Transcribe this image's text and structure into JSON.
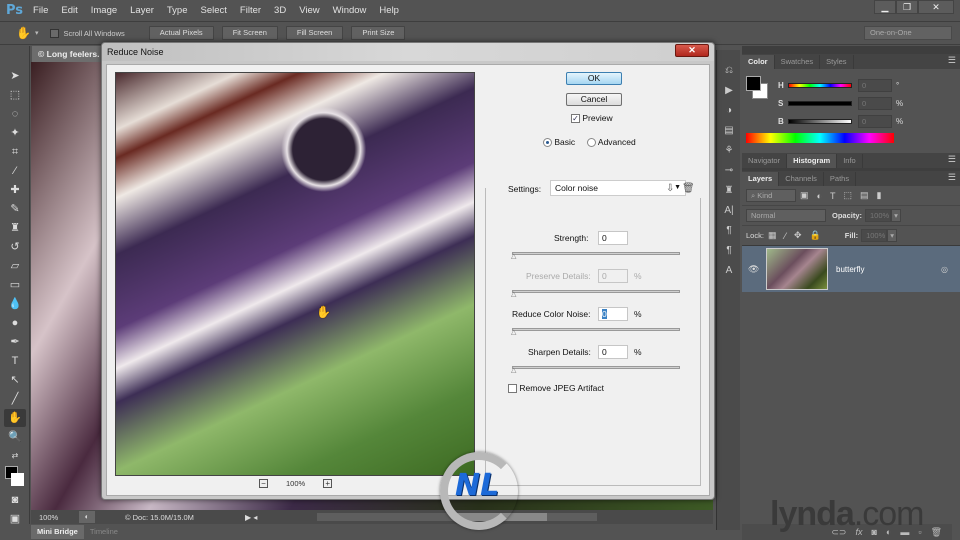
{
  "app": {
    "logo": "Ps"
  },
  "menu": [
    "File",
    "Edit",
    "Image",
    "Layer",
    "Type",
    "Select",
    "Filter",
    "3D",
    "View",
    "Window",
    "Help"
  ],
  "window_controls": {
    "minimize": "▁",
    "restore": "❐",
    "close": "✕"
  },
  "options_bar": {
    "scroll_all_windows": "Scroll All Windows",
    "buttons": [
      "Actual Pixels",
      "Fit Screen",
      "Fill Screen",
      "Print Size"
    ],
    "workspace": "One-on-One"
  },
  "document": {
    "tab_title": "© Long feelers.",
    "zoom": "100%",
    "doc_info": "© Doc: 15.0M/15.0M"
  },
  "bottom_tabs": [
    "Mini Bridge",
    "Timeline"
  ],
  "dialog": {
    "title": "Reduce Noise",
    "close": "✕",
    "ok": "OK",
    "cancel": "Cancel",
    "preview_label": "Preview",
    "preview_checked": true,
    "mode_basic": "Basic",
    "mode_advanced": "Advanced",
    "mode_selected": "Basic",
    "settings_label": "Settings:",
    "settings_value": "Color noise",
    "zoom": "100%",
    "zoom_out": "−",
    "zoom_in": "+",
    "strength_label": "Strength:",
    "strength_value": "0",
    "preserve_label": "Preserve Details:",
    "preserve_value": "0",
    "color_noise_label": "Reduce Color Noise:",
    "color_noise_value": "0",
    "sharpen_label": "Sharpen Details:",
    "sharpen_value": "0",
    "percent": "%",
    "jpeg_label": "Remove JPEG Artifact",
    "jpeg_checked": false
  },
  "color_panel": {
    "tabs": [
      "Color",
      "Swatches",
      "Styles"
    ],
    "active_tab": "Color",
    "h_label": "H",
    "h_value": "0",
    "h_unit": "°",
    "s_label": "S",
    "s_value": "0",
    "s_unit": "%",
    "b_label": "B",
    "b_value": "0",
    "b_unit": "%",
    "foreground": "#000000",
    "background": "#ffffff"
  },
  "nav_panel": {
    "tabs": [
      "Navigator",
      "Histogram",
      "Info"
    ],
    "active_tab": "Histogram"
  },
  "layers_panel": {
    "tabs": [
      "Layers",
      "Channels",
      "Paths"
    ],
    "active_tab": "Layers",
    "filter_kind": "Kind",
    "blend_mode": "Normal",
    "opacity_label": "Opacity:",
    "opacity_value": "100%",
    "lock_label": "Lock:",
    "fill_label": "Fill:",
    "fill_value": "100%",
    "layers": [
      {
        "name": "butterfly",
        "visible": true,
        "smart_object": true
      }
    ]
  },
  "watermark": {
    "lynda": "lynda",
    "dotcom": ".com",
    "logo": "NL"
  }
}
